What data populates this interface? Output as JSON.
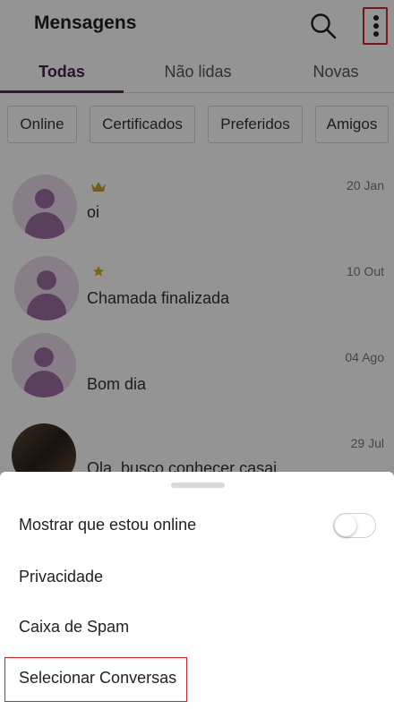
{
  "header": {
    "title": "Mensagens",
    "search_icon": "search-icon",
    "menu_icon": "more-vertical-icon"
  },
  "tabs": [
    {
      "label": "Todas",
      "active": true
    },
    {
      "label": "Não lidas",
      "active": false
    },
    {
      "label": "Novas",
      "active": false
    }
  ],
  "filters": [
    {
      "label": "Online"
    },
    {
      "label": "Certificados"
    },
    {
      "label": "Preferidos"
    },
    {
      "label": "Amigos"
    }
  ],
  "conversations": [
    {
      "message": "oi",
      "date": "20 Jan",
      "badge": "crown-icon"
    },
    {
      "message": "Chamada finalizada",
      "date": "10 Out",
      "badge": "star-icon"
    },
    {
      "message": "Bom dia",
      "date": "04 Ago",
      "badge": ""
    },
    {
      "message": "Ola, busco conhecer casai",
      "date": "29 Jul",
      "badge": ""
    }
  ],
  "sheet": {
    "items": [
      {
        "label": "Mostrar que estou online",
        "toggle_on": false
      },
      {
        "label": "Privacidade"
      },
      {
        "label": "Caixa de Spam"
      },
      {
        "label": "Selecionar Conversas"
      }
    ]
  },
  "colors": {
    "accent": "#5b2a5e",
    "highlight": "#d0242b",
    "overlay": "rgba(0,0,0,0.42)"
  }
}
